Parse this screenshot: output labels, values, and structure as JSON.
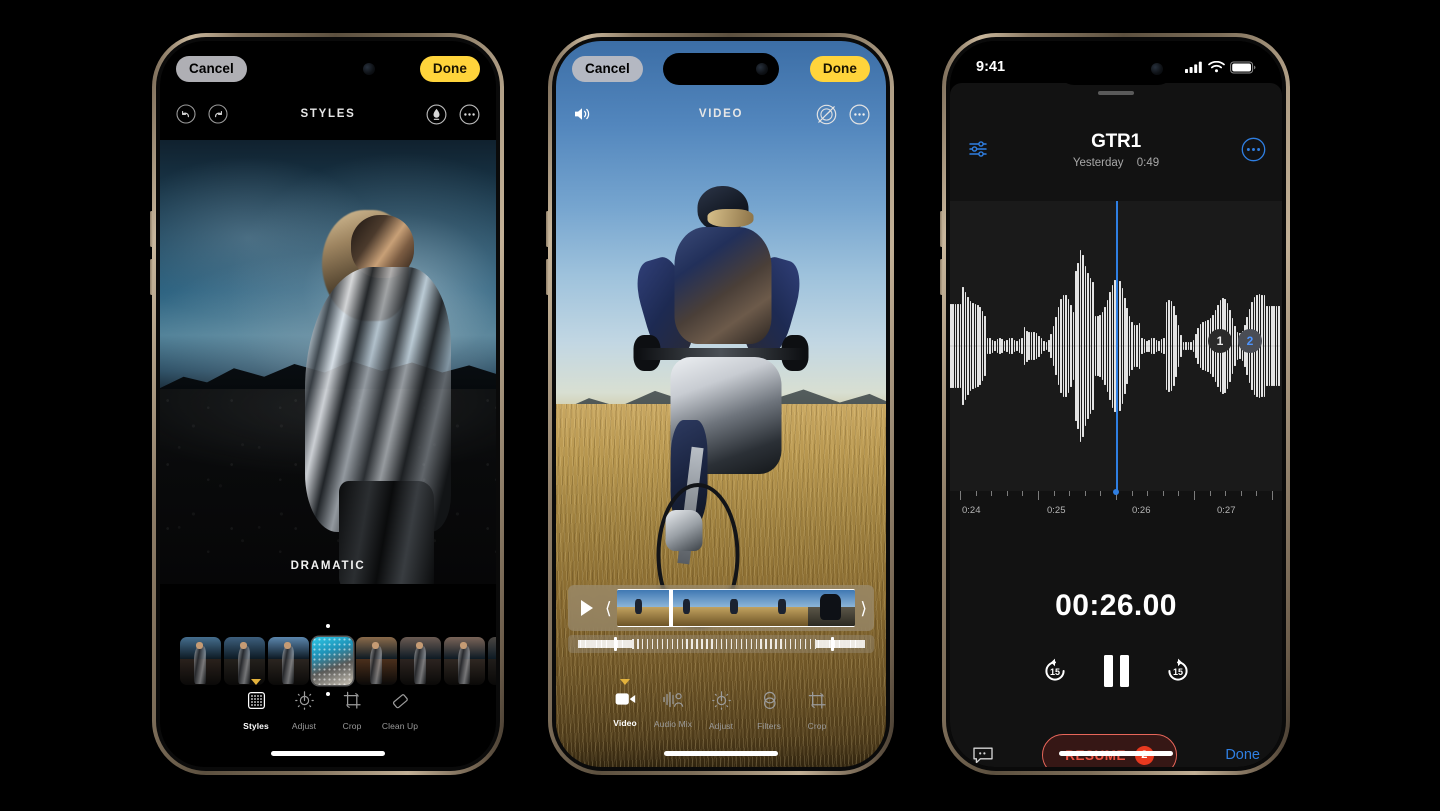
{
  "scene": {
    "background": "#000000",
    "device_frame_color": "#b09978"
  },
  "phone1": {
    "app": "Photos Editor",
    "topbar": {
      "cancel": "Cancel",
      "done": "Done"
    },
    "subbar": {
      "title": "STYLES",
      "icons": [
        "undo-icon",
        "redo-icon",
        "markup-icon",
        "more-options-icon"
      ]
    },
    "photo": {
      "style_label": "DRAMATIC"
    },
    "thumbnails": [
      {
        "name": "style-thumb-1",
        "selected": false
      },
      {
        "name": "style-thumb-2",
        "selected": false
      },
      {
        "name": "style-thumb-3",
        "selected": false
      },
      {
        "name": "style-thumb-4",
        "selected": true
      },
      {
        "name": "style-thumb-5",
        "selected": false
      },
      {
        "name": "style-thumb-6",
        "selected": false
      },
      {
        "name": "style-thumb-7",
        "selected": false
      },
      {
        "name": "style-thumb-8",
        "selected": false
      }
    ],
    "tools": [
      {
        "label": "Styles",
        "icon": "styles-grid-icon",
        "active": true
      },
      {
        "label": "Adjust",
        "icon": "adjust-brightness-icon",
        "active": false
      },
      {
        "label": "Crop",
        "icon": "crop-icon",
        "active": false
      },
      {
        "label": "Clean Up",
        "icon": "eraser-icon",
        "active": false
      }
    ]
  },
  "phone2": {
    "app": "Video Editor",
    "topbar": {
      "cancel": "Cancel",
      "done": "Done"
    },
    "subbar": {
      "title": "VIDEO",
      "icons": [
        "speaker-volume-icon",
        "playback-speed-icon",
        "more-options-icon"
      ]
    },
    "timeline": {
      "play_icon": "play-icon",
      "trim_left_icon": "trim-handle-left-icon",
      "trim_right_icon": "trim-handle-right-icon",
      "frames": 5,
      "playhead_percent": 22,
      "scrubber_left_handle_percent": 15,
      "scrubber_right_handle_percent": 86
    },
    "tools": [
      {
        "label": "Video",
        "icon": "video-camera-icon",
        "active": true
      },
      {
        "label": "Audio Mix",
        "icon": "audio-mix-icon",
        "active": false
      },
      {
        "label": "Adjust",
        "icon": "adjust-brightness-icon",
        "active": false
      },
      {
        "label": "Filters",
        "icon": "filters-circles-icon",
        "active": false
      },
      {
        "label": "Crop",
        "icon": "crop-icon",
        "active": false
      }
    ]
  },
  "phone3": {
    "app": "Voice Memos",
    "status_bar": {
      "time": "9:41",
      "icons": [
        "cellular-signal-icon",
        "wifi-icon",
        "battery-icon"
      ]
    },
    "header": {
      "title": "GTR1",
      "date": "Yesterday",
      "duration": "0:49",
      "left_icon": "equalizer-sliders-icon",
      "right_icon": "more-options-icon"
    },
    "segments": [
      {
        "label": "1",
        "selected": false
      },
      {
        "label": "2",
        "selected": true
      }
    ],
    "timeline": {
      "tick_labels": [
        "0:24",
        "0:25",
        "0:26",
        "0:27"
      ],
      "playhead_label": "0:26"
    },
    "current_time": "00:26.00",
    "transport": {
      "back_label": "15",
      "back_icon": "skip-back-15-icon",
      "pause_icon": "pause-icon",
      "forward_label": "15",
      "forward_icon": "skip-forward-15-icon"
    },
    "bottom": {
      "transcript_icon": "transcript-icon",
      "resume_label": "RESUME",
      "resume_badge": "2",
      "resume_color": "#F05545",
      "done_label": "Done",
      "done_color": "#2f7FE3"
    }
  }
}
